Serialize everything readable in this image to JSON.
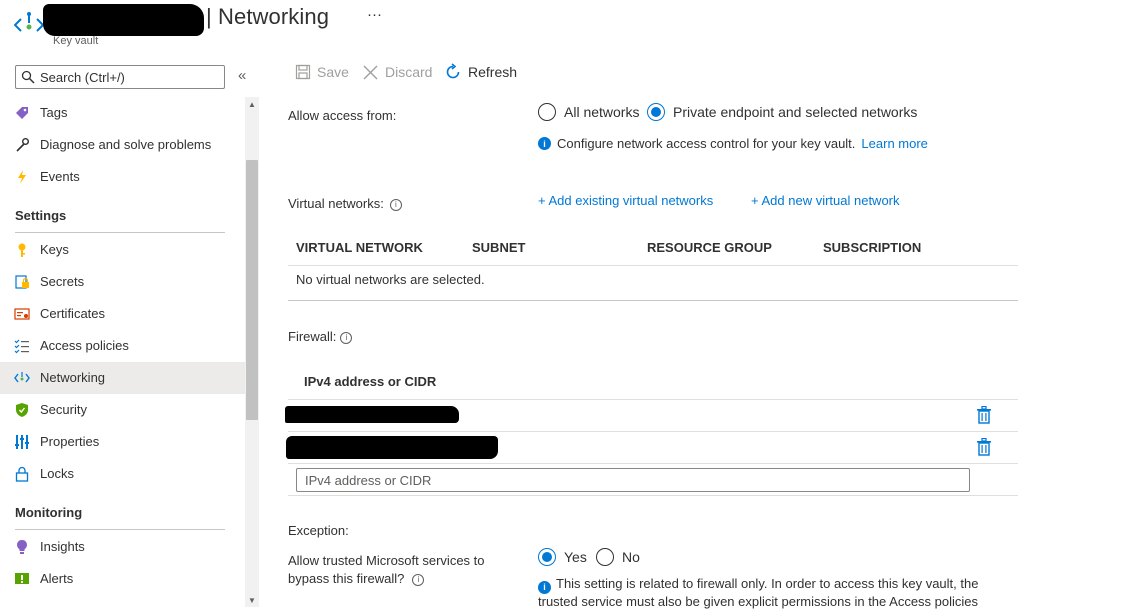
{
  "header": {
    "title": "| Networking",
    "more": "···",
    "subtitle": "Key vault"
  },
  "sidebar": {
    "search_placeholder": "Search (Ctrl+/)",
    "collapse": "«",
    "top_items": [
      {
        "label": "Tags",
        "icon": "tag-icon"
      },
      {
        "label": "Diagnose and solve problems",
        "icon": "wrench-icon"
      },
      {
        "label": "Events",
        "icon": "lightning-icon"
      }
    ],
    "settings_title": "Settings",
    "settings_items": [
      {
        "label": "Keys",
        "icon": "key-icon"
      },
      {
        "label": "Secrets",
        "icon": "secret-icon"
      },
      {
        "label": "Certificates",
        "icon": "certificate-icon"
      },
      {
        "label": "Access policies",
        "icon": "access-policies-icon"
      },
      {
        "label": "Networking",
        "icon": "networking-icon",
        "active": true
      },
      {
        "label": "Security",
        "icon": "shield-icon"
      },
      {
        "label": "Properties",
        "icon": "properties-icon"
      },
      {
        "label": "Locks",
        "icon": "lock-icon"
      }
    ],
    "monitoring_title": "Monitoring",
    "monitoring_items": [
      {
        "label": "Insights",
        "icon": "insights-icon"
      },
      {
        "label": "Alerts",
        "icon": "alerts-icon"
      }
    ]
  },
  "toolbar": {
    "save": "Save",
    "discard": "Discard",
    "refresh": "Refresh"
  },
  "access": {
    "label": "Allow access from:",
    "options": [
      "All networks",
      "Private endpoint and selected networks"
    ],
    "selected": "Private endpoint and selected networks",
    "info": "Configure network access control for your key vault.",
    "learn_more": "Learn more"
  },
  "vnet": {
    "label": "Virtual networks:",
    "add_existing": "+ Add existing virtual networks",
    "add_new": "+ Add new virtual network",
    "columns": [
      "VIRTUAL NETWORK",
      "SUBNET",
      "RESOURCE GROUP",
      "SUBSCRIPTION"
    ],
    "empty": "No virtual networks are selected."
  },
  "firewall": {
    "label": "Firewall:",
    "column": "IPv4 address or CIDR",
    "input_placeholder": "IPv4 address or CIDR"
  },
  "exception": {
    "label": "Exception:",
    "question_line1": "Allow trusted Microsoft services to",
    "question_line2": "bypass this firewall?",
    "yes": "Yes",
    "no": "No",
    "selected": "Yes",
    "note": "This setting is related to firewall only. In order to access this key vault, the trusted service must also be given explicit permissions in the Access policies"
  },
  "colors": {
    "accent": "#0078d4",
    "text": "#323130",
    "active_bg": "#edebe9"
  }
}
